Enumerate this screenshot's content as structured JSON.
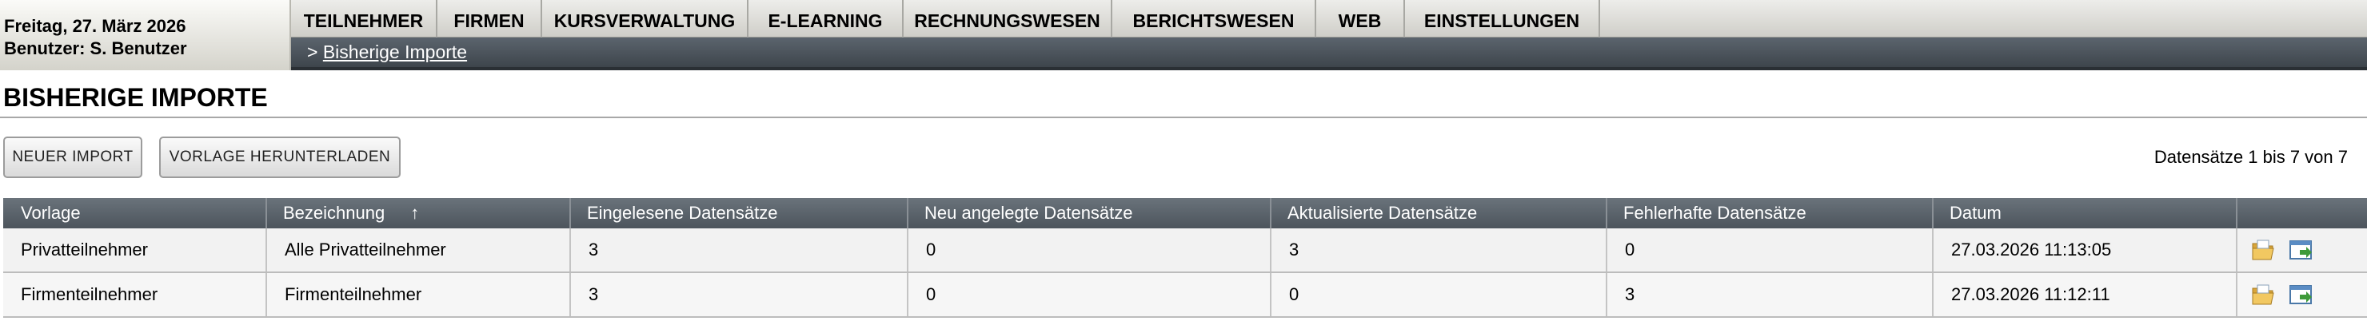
{
  "header": {
    "date": "Freitag, 27. März 2026",
    "user": "Benutzer: S. Benutzer"
  },
  "nav": {
    "items": [
      {
        "label": "TEILNEHMER"
      },
      {
        "label": "FIRMEN"
      },
      {
        "label": "KURSVERWALTUNG"
      },
      {
        "label": "E-LEARNING"
      },
      {
        "label": "RECHNUNGSWESEN"
      },
      {
        "label": "BERICHTSWESEN"
      },
      {
        "label": "WEB"
      },
      {
        "label": "EINSTELLUNGEN"
      }
    ]
  },
  "breadcrumb": {
    "separator": ">",
    "current": "Bisherige Importe"
  },
  "page": {
    "title": "BISHERIGE IMPORTE"
  },
  "toolbar": {
    "new_import_label": "NEUER IMPORT",
    "download_template_label": "VORLAGE HERUNTERLADEN",
    "record_count": "Datensätze 1 bis 7 von 7"
  },
  "table": {
    "headers": {
      "vorlage": "Vorlage",
      "bezeichnung": "Bezeichnung",
      "sort_indicator": "↑",
      "eingelesen": "Eingelesene Datensätze",
      "neu": "Neu angelegte Datensätze",
      "aktualisiert": "Aktualisierte Datensätze",
      "fehlerhaft": "Fehlerhafte Datensätze",
      "datum": "Datum"
    },
    "rows": [
      {
        "vorlage": "Privatteilnehmer",
        "bezeichnung": "Alle Privatteilnehmer",
        "eingelesen": "3",
        "neu": "0",
        "aktualisiert": "3",
        "fehlerhaft": "0",
        "datum": "27.03.2026 11:13:05",
        "icons": [
          "folder-open-icon",
          "window-import-icon"
        ]
      },
      {
        "vorlage": "Firmenteilnehmer",
        "bezeichnung": "Firmenteilnehmer",
        "eingelesen": "3",
        "neu": "0",
        "aktualisiert": "0",
        "fehlerhaft": "3",
        "datum": "27.03.2026 11:12:11",
        "icons": [
          "folder-open-icon",
          "window-import-icon"
        ]
      }
    ]
  },
  "colors": {
    "nav_bg": "#dcdbd5",
    "crumb_bar": "#4c545c",
    "table_header": "#5a626a",
    "folder_icon": "#e8b84a",
    "import_icon_accent": "#3f9a3a"
  }
}
